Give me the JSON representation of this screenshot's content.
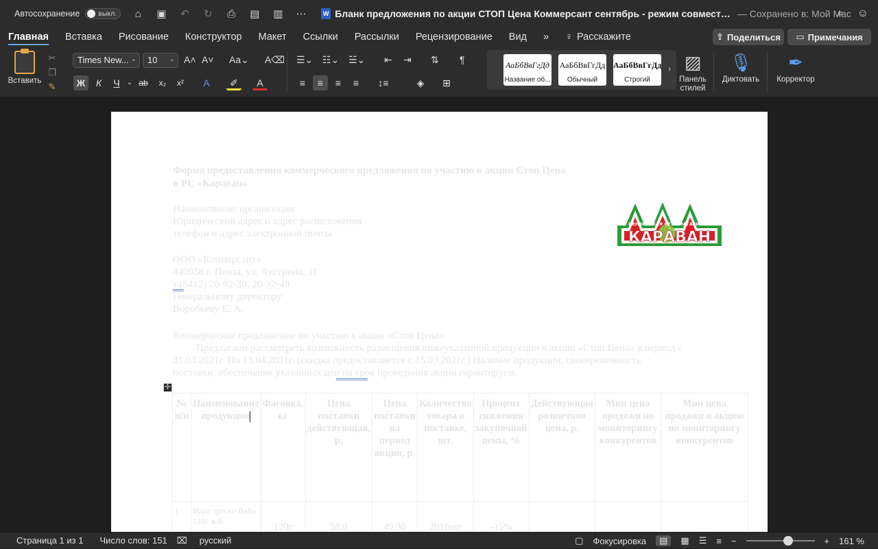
{
  "titlebar": {
    "autosave_label": "Автосохранение",
    "autosave_state": "выкл.",
    "doc_title": "Бланк предложения по акции СТОП Цена Коммерсант сентябрь  -  режим совмест…",
    "saved_status": "— Сохранено в: Мой Mac"
  },
  "tabs": [
    "Главная",
    "Вставка",
    "Рисование",
    "Конструктор",
    "Макет",
    "Ссылки",
    "Рассылки",
    "Рецензирование",
    "Вид"
  ],
  "tell_me": "Расскажите",
  "share_label": "Поделиться",
  "notes_label": "Примечания",
  "ribbon": {
    "paste_label": "Вставить",
    "font_name": "Times New...",
    "font_size": "10",
    "styles": [
      {
        "sample": "АаБбВвГгДд",
        "name": "Название об..."
      },
      {
        "sample": "АаБбВвГгДд",
        "name": "Обычный"
      },
      {
        "sample": "АаБбВвГгДд",
        "name": "Строгий"
      }
    ],
    "styles_pane_label_1": "Панель",
    "styles_pane_label_2": "стилей",
    "dictate_label": "Диктовать",
    "editor_label": "Корректор"
  },
  "document": {
    "heading_line1": "Форма предоставления коммерческого предложения по участию в акции Стоп Цена",
    "heading_line2": "в РС «Караван»",
    "org_line1": "Наименование организации",
    "org_line2": "Юридический адрес и адрес расположения",
    "org_line3": "телефон и адрес электронной почты",
    "to_line1": "ООО «Коммерсант»",
    "to_line2": "440058 г. Пенза, ул. Аустрина, 1Г",
    "to_line3": "т.(8412) 20-92-30, 20-92-48",
    "to_line4": "Генеральному директору",
    "to_line5": "Воробьеву Е. А.",
    "offer_title": "Коммерческое предложение по участию в акции «Стоп Цена»",
    "offer_p1": "Предлагаем рассмотреть возможность размещения нижеуказанной продукции в акции «Стоп Цена» в период с",
    "offer_p2": "31.03.2021г. По 13.04.2021г. (скидка предоставляется с 15.03.2021г.) Наличие продукции, своевременность",
    "offer_p3": "поставки, обеспечение указанных цен на срок проведения акции гарантируем.",
    "logo_text": "КАРАВАН",
    "logo_subtext": "ПЕНЗЕНСКАЯ СЕТЬ МАГАЗИНОВ",
    "table": {
      "headers": [
        "№ п/п",
        "Наименование продукции",
        "Фасовка, кг",
        "Цена поставки действующая, р.",
        "Цена поставки на период акции, р.",
        "Количество товара в поставке, шт.",
        "Процент снижения закупочной цены, %",
        "Действующая розничная цена, р.",
        "Мин цена продажи по мониторингу конкурентов",
        "Мин цена продажи в акцию по мониторингу конкурентов"
      ],
      "row1": [
        "1",
        "Икра трески Balta 120г ж/б",
        "120г",
        "58,0",
        "49,30",
        "2016шт",
        "-15%",
        "",
        "",
        ""
      ]
    }
  },
  "statusbar": {
    "page": "Страница 1 из 1",
    "words": "Число слов: 151",
    "language": "русский",
    "focus": "Фокусировка",
    "zoom": "161 %"
  }
}
